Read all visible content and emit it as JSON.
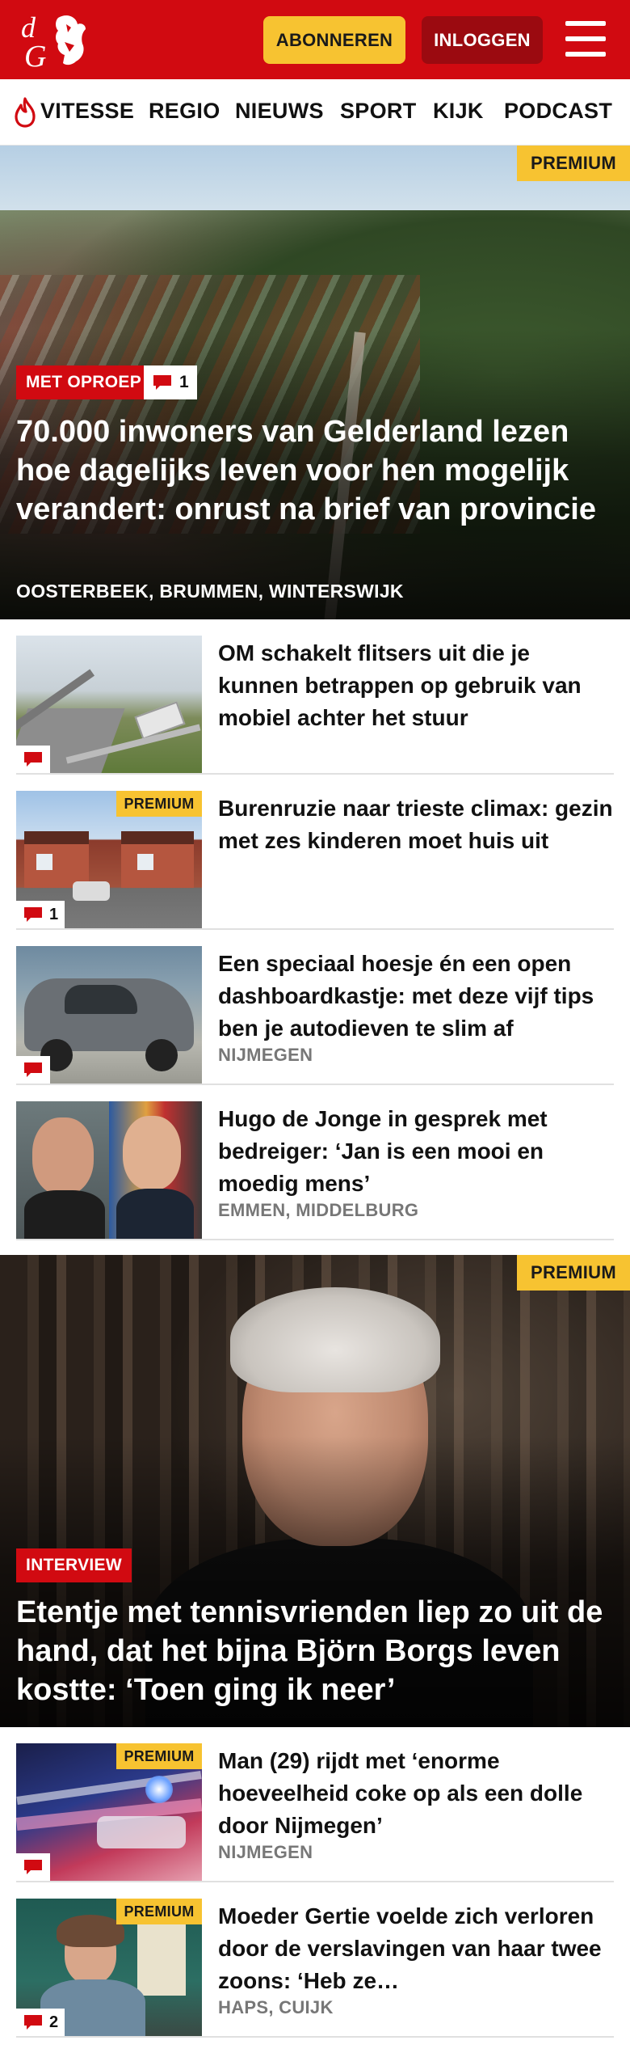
{
  "header": {
    "logo_text": "dG",
    "subscribe_label": "ABONNEREN",
    "login_label": "INLOGGEN",
    "brand_color": "#d10a11"
  },
  "nav": {
    "items": [
      "VITESSE",
      "REGIO",
      "NIEUWS",
      "SPORT",
      "KIJK",
      "PODCAST"
    ]
  },
  "hero1": {
    "premium": "PREMIUM",
    "label": "MET OPROEP",
    "comments": "1",
    "title": "70.000 inwoners van Gelderland lezen hoe dagelijks leven voor hen mogelijk verandert: onrust na brief van provincie",
    "locations": "OOSTERBEEK, BRUMMEN, WINTERSWIJK"
  },
  "articles": [
    {
      "title": "OM schakelt flitsers uit die je kunnen betrappen op gebruik van mobiel achter het stuur",
      "location": "",
      "premium": "",
      "comments": ""
    },
    {
      "title": "Burenruzie naar trieste climax: gezin met zes kinderen moet huis uit",
      "location": "",
      "premium": "PREMIUM",
      "comments": "1"
    },
    {
      "title": "Een speciaal hoesje én een open dashboardkastje: met deze vijf tips ben je autodieven te slim af",
      "location": "NIJMEGEN",
      "premium": "",
      "comments": ""
    },
    {
      "title": "Hugo de Jonge in gesprek met bedreiger: ‘Jan is een mooi en moedig mens’",
      "location": "EMMEN, MIDDELBURG",
      "premium": "",
      "comments": ""
    }
  ],
  "hero2": {
    "premium": "PREMIUM",
    "label": "INTERVIEW",
    "title": "Etentje met tennisvrienden liep zo uit de hand, dat het bijna Björn Borgs leven kostte: ‘Toen ging ik neer’"
  },
  "articles2": [
    {
      "title": "Man (29) rijdt met ‘enorme hoeveelheid coke op als een dolle door Nijmegen’",
      "location": "NIJMEGEN",
      "premium": "PREMIUM",
      "comments": ""
    },
    {
      "title": "Moeder Gertie voelde zich verloren door de verslavingen van haar twee zoons: ‘Heb ze…",
      "location": "HAPS, CUIJK",
      "premium": "PREMIUM",
      "comments": "2"
    }
  ],
  "icons": {
    "menu": "hamburger-menu-icon",
    "flame": "flame-icon",
    "comment": "comment-bubble-icon"
  }
}
